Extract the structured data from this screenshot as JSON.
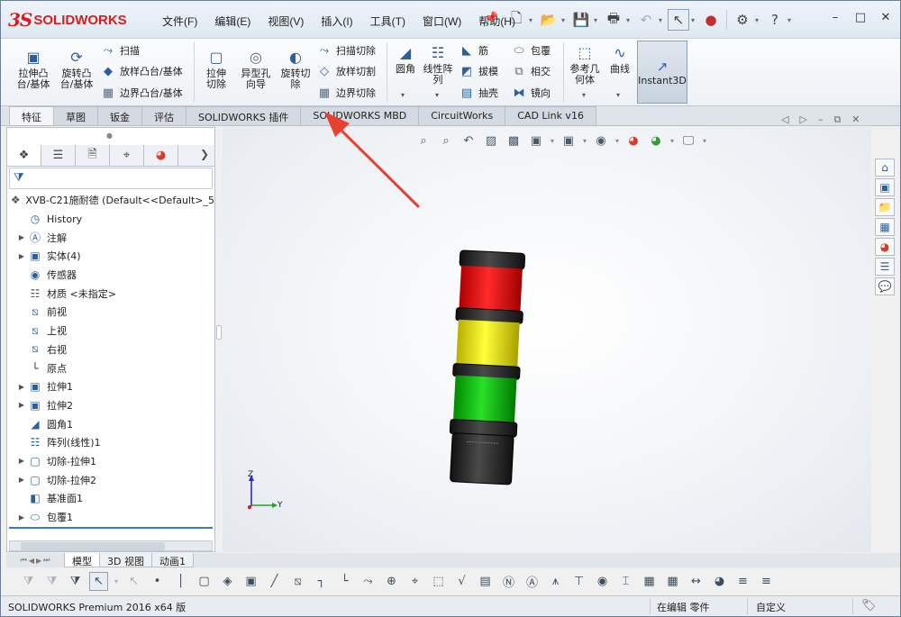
{
  "titlebar": {
    "logo_ds": "3S",
    "logo_text": "SOLIDWORKS",
    "menu": [
      "文件(F)",
      "编辑(E)",
      "视图(V)",
      "插入(I)",
      "工具(T)",
      "窗口(W)",
      "帮助(H)"
    ]
  },
  "ribbon": {
    "extrude_boss": "拉伸凸台/基体",
    "revolve_boss": "旋转凸台/基体",
    "sweep": "扫描",
    "loft_boss": "放样凸台/基体",
    "boundary_boss": "边界凸台/基体",
    "extrude_cut": "拉伸切除",
    "hole_wizard": "异型孔向导",
    "revolve_cut": "旋转切除",
    "swept_cut": "扫描切除",
    "lofted_cut": "放样切割",
    "boundary_cut": "边界切除",
    "fillet": "圆角",
    "linear_pattern": "线性阵列",
    "rib": "筋",
    "draft": "拔模",
    "shell": "抽壳",
    "wrap": "包覆",
    "intersect": "相交",
    "mirror": "镜向",
    "ref_geometry": "参考几何体",
    "curves": "曲线",
    "instant3d": "Instant3D"
  },
  "tabs": [
    "特征",
    "草图",
    "钣金",
    "评估",
    "SOLIDWORKS 插件",
    "SOLIDWORKS MBD",
    "CircuitWorks",
    "CAD Link v16"
  ],
  "tree": {
    "root": "XVB-C21施耐德  (Default<<Default>_5",
    "items": [
      "History",
      "注解",
      "实体(4)",
      "传感器",
      "材质 <未指定>",
      "前视",
      "上视",
      "右视",
      "原点",
      "拉伸1",
      "拉伸2",
      "圆角1",
      "阵列(线性)1",
      "切除-拉伸1",
      "切除-拉伸2",
      "基准面1",
      "包覆1"
    ]
  },
  "bottom_tabs": [
    "模型",
    "3D 视图",
    "动画1"
  ],
  "status": {
    "left": "SOLIDWORKS Premium 2016 x64 版",
    "mid": "在编辑 零件",
    "right": "自定义"
  },
  "triad": {
    "z": "Z",
    "y": "Y"
  },
  "colors": {
    "accent": "#2d5f9e",
    "brand": "#d42020",
    "arrow": "#e8412f",
    "light_red": "#e01010",
    "light_yellow": "#e8e010",
    "light_green": "#10c010"
  }
}
